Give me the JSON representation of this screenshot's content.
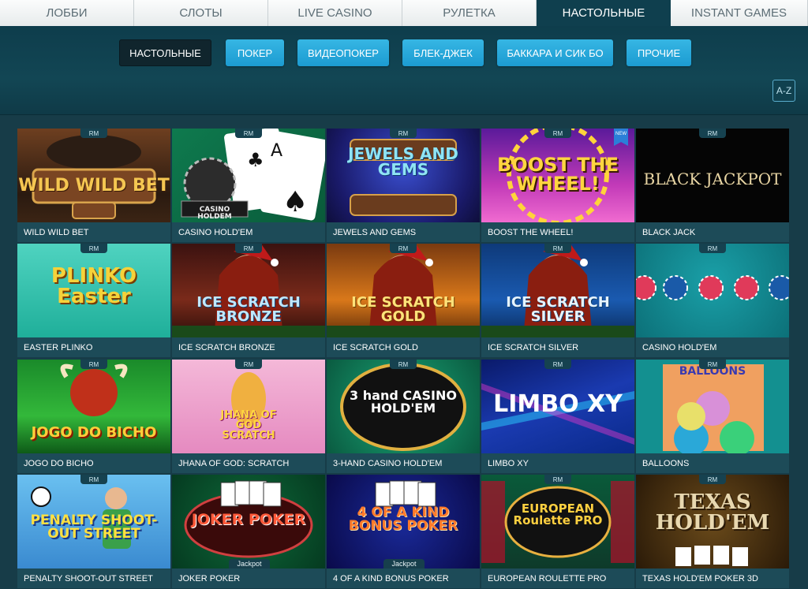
{
  "top_tabs": [
    {
      "label": "ЛОББИ",
      "active": false
    },
    {
      "label": "СЛОТЫ",
      "active": false
    },
    {
      "label": "LIVE CASINO",
      "active": false
    },
    {
      "label": "РУЛЕТКА",
      "active": false
    },
    {
      "label": "НАСТОЛЬНЫЕ",
      "active": true
    },
    {
      "label": "INSTANT GAMES",
      "active": false
    }
  ],
  "categories": [
    {
      "label": "НАСТОЛЬНЫЕ",
      "selected": true
    },
    {
      "label": "ПОКЕР",
      "selected": false
    },
    {
      "label": "ВИДЕОПОКЕР",
      "selected": false
    },
    {
      "label": "БЛЕК-ДЖЕК",
      "selected": false
    },
    {
      "label": "БАККАРА И СИК БО",
      "selected": false
    },
    {
      "label": "ПРОЧИЕ",
      "selected": false
    }
  ],
  "sort_button": "A-Z",
  "badge_rm": "RM",
  "badge_new": "NEW",
  "badge_jackpot": "Jackpot",
  "games": [
    {
      "name": "WILD WILD BET",
      "art": "WILD WILD BET"
    },
    {
      "name": "CASINO HOLD'EM",
      "art": "CASINO HOLDEM"
    },
    {
      "name": "JEWELS AND GEMS",
      "art": "JEWELS AND GEMS"
    },
    {
      "name": "BOOST THE WHEEL!",
      "art": "BOOST THE WHEEL!"
    },
    {
      "name": "BLACK JACK",
      "art": "BLACK JACKPOT"
    },
    {
      "name": "EASTER PLINKO",
      "art": "PLINKO Easter"
    },
    {
      "name": "ICE SCRATCH BRONZE",
      "art": "ICE SCRATCH BRONZE"
    },
    {
      "name": "ICE SCRATCH GOLD",
      "art": "ICE SCRATCH GOLD"
    },
    {
      "name": "ICE SCRATCH SILVER",
      "art": "ICE SCRATCH SILVER"
    },
    {
      "name": "CASINO HOLD'EM",
      "art": ""
    },
    {
      "name": "JOGO DO BICHO",
      "art": "JOGO DO BICHO"
    },
    {
      "name": "JHANA OF GOD: SCRATCH",
      "art": "JHANA OF GOD SCRATCH"
    },
    {
      "name": "3-HAND CASINO HOLD'EM",
      "art": "3 hand CASINO HOLD'EM"
    },
    {
      "name": "LIMBO XY",
      "art": "LIMBO XY"
    },
    {
      "name": "BALLOONS",
      "art": "BALLOONS"
    },
    {
      "name": "PENALTY SHOOT-OUT STREET",
      "art": "PENALTY SHOOT-OUT STREET"
    },
    {
      "name": "JOKER POKER",
      "art": "JOKER POKER"
    },
    {
      "name": "4 OF A KIND BONUS POKER",
      "art": "4 OF A KIND BONUS POKER"
    },
    {
      "name": "EUROPEAN ROULETTE PRO",
      "art": "EUROPEAN Roulette PRO"
    },
    {
      "name": "TEXAS HOLD'EM POKER 3D",
      "art": "TEXAS HOLD'EM"
    }
  ],
  "colors": {
    "accent": "#1c9bd1",
    "tab_active": "#0f3f4e",
    "label_bg": "#1d4b58"
  }
}
